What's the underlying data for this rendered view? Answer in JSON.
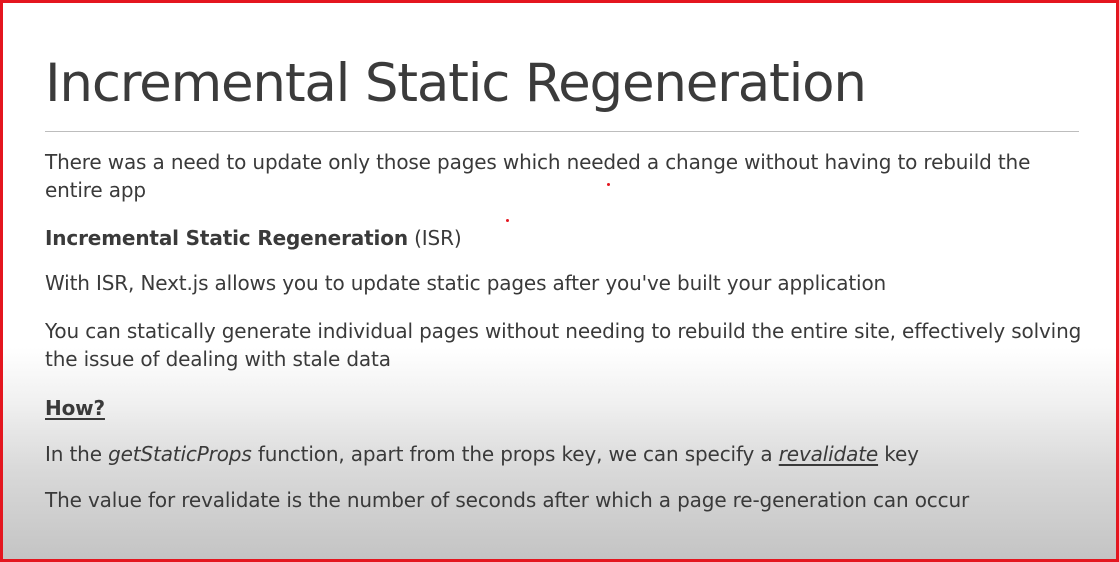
{
  "slide": {
    "title": "Incremental Static Regeneration",
    "p1": "There was a need to update only those pages which needed a change without having to rebuild the entire app",
    "p2_bold": "Incremental Static Regeneration",
    "p2_rest": " (ISR)",
    "p3": "With ISR, Next.js allows you to update static pages after you've built your application",
    "p4": "You can statically generate individual pages without needing to rebuild the entire site, effectively solving the issue of dealing with stale data",
    "p5": "How?",
    "p6_a": "In the ",
    "p6_italic": "getStaticProps",
    "p6_b": " function, apart from the props key, we can specify a ",
    "p6_ul": "revalidate",
    "p6_c": " key",
    "p7": "The value for revalidate is the number of seconds after which a page re-generation can occur"
  },
  "colors": {
    "border": "#e4161f",
    "text": "#3a3a3a",
    "pointer_dot": "#e4161f"
  }
}
